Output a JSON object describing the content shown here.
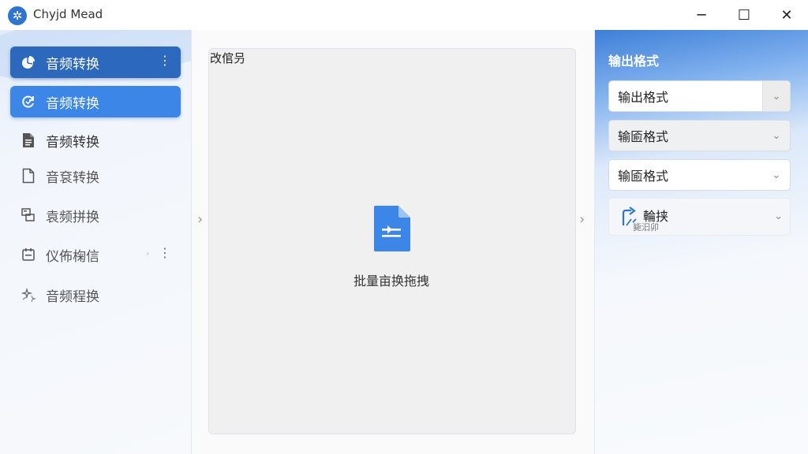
{
  "app": {
    "title": "Chyjd Mead",
    "logo_glyph": "✲"
  },
  "window_controls": {
    "minimize": "─",
    "maximize": "☐",
    "close": "✕"
  },
  "sidebar": {
    "items": [
      {
        "label": "音频转换",
        "icon": "pie-chart-icon",
        "more": "⋮"
      },
      {
        "label": "音频转换",
        "icon": "refresh-icon"
      },
      {
        "label": "音频转换",
        "icon": "document-icon"
      },
      {
        "label": "音袞转换",
        "icon": "file-icon"
      },
      {
        "label": "袁频拼换",
        "icon": "gallery-icon"
      },
      {
        "label": "仪佈椈信",
        "icon": "calendar-icon",
        "chevron": "›",
        "more": "⋮"
      },
      {
        "label": "音频程换",
        "icon": "sparkle-icon"
      }
    ]
  },
  "center": {
    "title": "改倌叧",
    "drop_text": "批量亩换拖拽",
    "left_chevron": "›",
    "right_chevron": "›"
  },
  "right": {
    "title": "输出格式",
    "selects": [
      {
        "value": "输出格式"
      },
      {
        "value": "输匬格式"
      },
      {
        "value": "输匬格式"
      }
    ],
    "convert": {
      "label": "輪挟",
      "sub": "毙汩卯"
    },
    "chevron": "⌄"
  },
  "colors": {
    "accent": "#2c68bb",
    "accent_light": "#3b86e6",
    "file_icon": "#3b86e6"
  }
}
